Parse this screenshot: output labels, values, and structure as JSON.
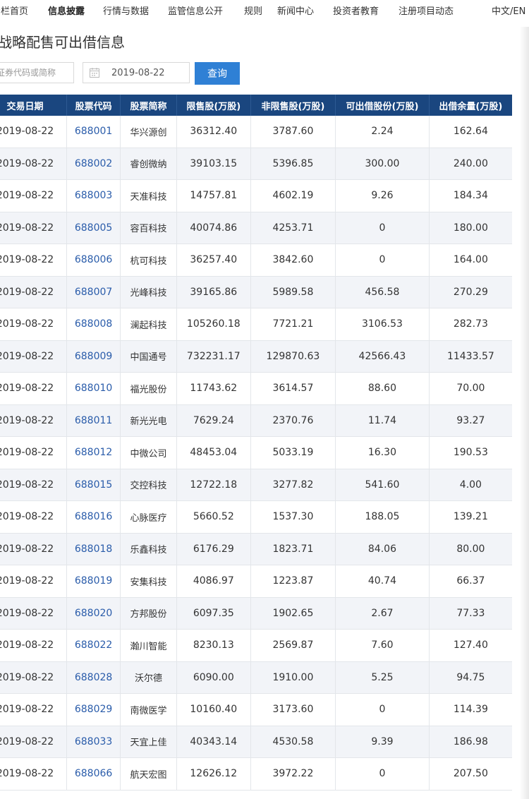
{
  "nav": {
    "items": [
      {
        "label": "专栏首页",
        "active": false
      },
      {
        "label": "信息披露",
        "active": true
      },
      {
        "label": "行情与数据",
        "active": false
      },
      {
        "label": "监管信息公开",
        "active": false
      },
      {
        "label": "规则",
        "active": false
      },
      {
        "label": "新闻中心",
        "active": false
      },
      {
        "label": "投资者教育",
        "active": false
      },
      {
        "label": "注册项目动态",
        "active": false
      }
    ],
    "lang": "中文/EN"
  },
  "page": {
    "title": "战略配售可出借信息"
  },
  "search": {
    "placeholder": "证券代码或简称",
    "date_value": "2019-08-22",
    "query_label": "查询"
  },
  "table": {
    "headers": [
      "交易日期",
      "股票代码",
      "股票简称",
      "限售股(万股)",
      "非限售股(万股)",
      "可出借股份(万股)",
      "出借余量(万股)"
    ],
    "rows": [
      [
        "2019-08-22",
        "688001",
        "华兴源创",
        "36312.40",
        "3787.60",
        "2.24",
        "162.64"
      ],
      [
        "2019-08-22",
        "688002",
        "睿创微纳",
        "39103.15",
        "5396.85",
        "300.00",
        "240.00"
      ],
      [
        "2019-08-22",
        "688003",
        "天准科技",
        "14757.81",
        "4602.19",
        "9.26",
        "184.34"
      ],
      [
        "2019-08-22",
        "688005",
        "容百科技",
        "40074.86",
        "4253.71",
        "0",
        "180.00"
      ],
      [
        "2019-08-22",
        "688006",
        "杭可科技",
        "36257.40",
        "3842.60",
        "0",
        "164.00"
      ],
      [
        "2019-08-22",
        "688007",
        "光峰科技",
        "39165.86",
        "5989.58",
        "456.58",
        "270.29"
      ],
      [
        "2019-08-22",
        "688008",
        "澜起科技",
        "105260.18",
        "7721.21",
        "3106.53",
        "282.73"
      ],
      [
        "2019-08-22",
        "688009",
        "中国通号",
        "732231.17",
        "129870.63",
        "42566.43",
        "11433.57"
      ],
      [
        "2019-08-22",
        "688010",
        "福光股份",
        "11743.62",
        "3614.57",
        "88.60",
        "70.00"
      ],
      [
        "2019-08-22",
        "688011",
        "新光光电",
        "7629.24",
        "2370.76",
        "11.74",
        "93.27"
      ],
      [
        "2019-08-22",
        "688012",
        "中微公司",
        "48453.04",
        "5033.19",
        "16.30",
        "190.53"
      ],
      [
        "2019-08-22",
        "688015",
        "交控科技",
        "12722.18",
        "3277.82",
        "541.60",
        "4.00"
      ],
      [
        "2019-08-22",
        "688016",
        "心脉医疗",
        "5660.52",
        "1537.30",
        "188.05",
        "139.21"
      ],
      [
        "2019-08-22",
        "688018",
        "乐鑫科技",
        "6176.29",
        "1823.71",
        "84.06",
        "80.00"
      ],
      [
        "2019-08-22",
        "688019",
        "安集科技",
        "4086.97",
        "1223.87",
        "40.74",
        "66.37"
      ],
      [
        "2019-08-22",
        "688020",
        "方邦股份",
        "6097.35",
        "1902.65",
        "2.67",
        "77.33"
      ],
      [
        "2019-08-22",
        "688022",
        "瀚川智能",
        "8230.13",
        "2569.87",
        "7.60",
        "127.40"
      ],
      [
        "2019-08-22",
        "688028",
        "沃尔德",
        "6090.00",
        "1910.00",
        "5.25",
        "94.75"
      ],
      [
        "2019-08-22",
        "688029",
        "南微医学",
        "10160.40",
        "3173.60",
        "0",
        "114.39"
      ],
      [
        "2019-08-22",
        "688033",
        "天宜上佳",
        "40343.14",
        "4530.58",
        "9.39",
        "186.98"
      ],
      [
        "2019-08-22",
        "688066",
        "航天宏图",
        "12626.12",
        "3972.22",
        "0",
        "207.50"
      ]
    ]
  },
  "colors": {
    "header_bg": "#1a467f",
    "button_bg": "#2f80d5",
    "link": "#2a5caa",
    "row_alt": "#f2f4f8"
  },
  "icons": {
    "date": "calendar-icon"
  }
}
